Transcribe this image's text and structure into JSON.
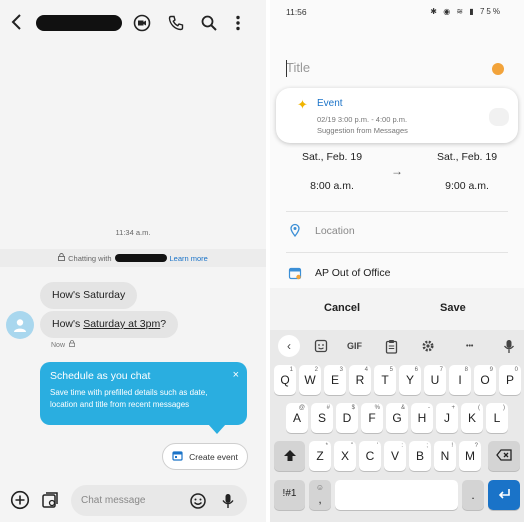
{
  "left": {
    "time": "11:34 a.m.",
    "chatting_prefix": "Chatting with",
    "learn_more": "Learn more",
    "messages": [
      "How's Saturday",
      "How's ",
      "Saturday at 3pm",
      "?"
    ],
    "now": "Now",
    "tip": {
      "title": "Schedule as you chat",
      "body": "Save time with prefilled details such as date, location and title from recent messages",
      "close": "×"
    },
    "create_event": "Create event",
    "input_placeholder": "Chat message"
  },
  "right": {
    "status_time": "11:56",
    "status_icons": "✱ ◉ ≋ ▮",
    "battery": "75%",
    "title_placeholder": "Title",
    "suggestion": {
      "title": "Event",
      "line1": "02/19 3:00 p.m. - 4:00 p.m.",
      "line2": "Suggestion from Messages"
    },
    "start_date": "Sat., Feb. 19",
    "start_time": "8:00 a.m.",
    "end_date": "Sat., Feb. 19",
    "end_time": "9:00 a.m.",
    "arrow": "→",
    "location": "Location",
    "calendar": "AP Out of Office",
    "cancel": "Cancel",
    "save": "Save"
  },
  "keyboard": {
    "gif": "GIF",
    "dots": "•••",
    "row1": [
      {
        "k": "Q",
        "n": "1"
      },
      {
        "k": "W",
        "n": "2"
      },
      {
        "k": "E",
        "n": "3"
      },
      {
        "k": "R",
        "n": "4"
      },
      {
        "k": "T",
        "n": "5"
      },
      {
        "k": "Y",
        "n": "6"
      },
      {
        "k": "U",
        "n": "7"
      },
      {
        "k": "I",
        "n": "8"
      },
      {
        "k": "O",
        "n": "9"
      },
      {
        "k": "P",
        "n": "0"
      }
    ],
    "row2": [
      {
        "k": "A",
        "n": "@"
      },
      {
        "k": "S",
        "n": "#"
      },
      {
        "k": "D",
        "n": "$"
      },
      {
        "k": "F",
        "n": "%"
      },
      {
        "k": "G",
        "n": "&"
      },
      {
        "k": "H",
        "n": "-"
      },
      {
        "k": "J",
        "n": "+"
      },
      {
        "k": "K",
        "n": "("
      },
      {
        "k": "L",
        "n": ")"
      }
    ],
    "row3": [
      {
        "k": "Z",
        "n": "*"
      },
      {
        "k": "X",
        "n": "\""
      },
      {
        "k": "C",
        "n": "'"
      },
      {
        "k": "V",
        "n": ":"
      },
      {
        "k": "B",
        "n": ";"
      },
      {
        "k": "N",
        "n": "!"
      },
      {
        "k": "M",
        "n": "?"
      }
    ],
    "sym": "!#1",
    "comma": ",",
    "period": ".",
    "accent_color": "#1a73c8"
  }
}
